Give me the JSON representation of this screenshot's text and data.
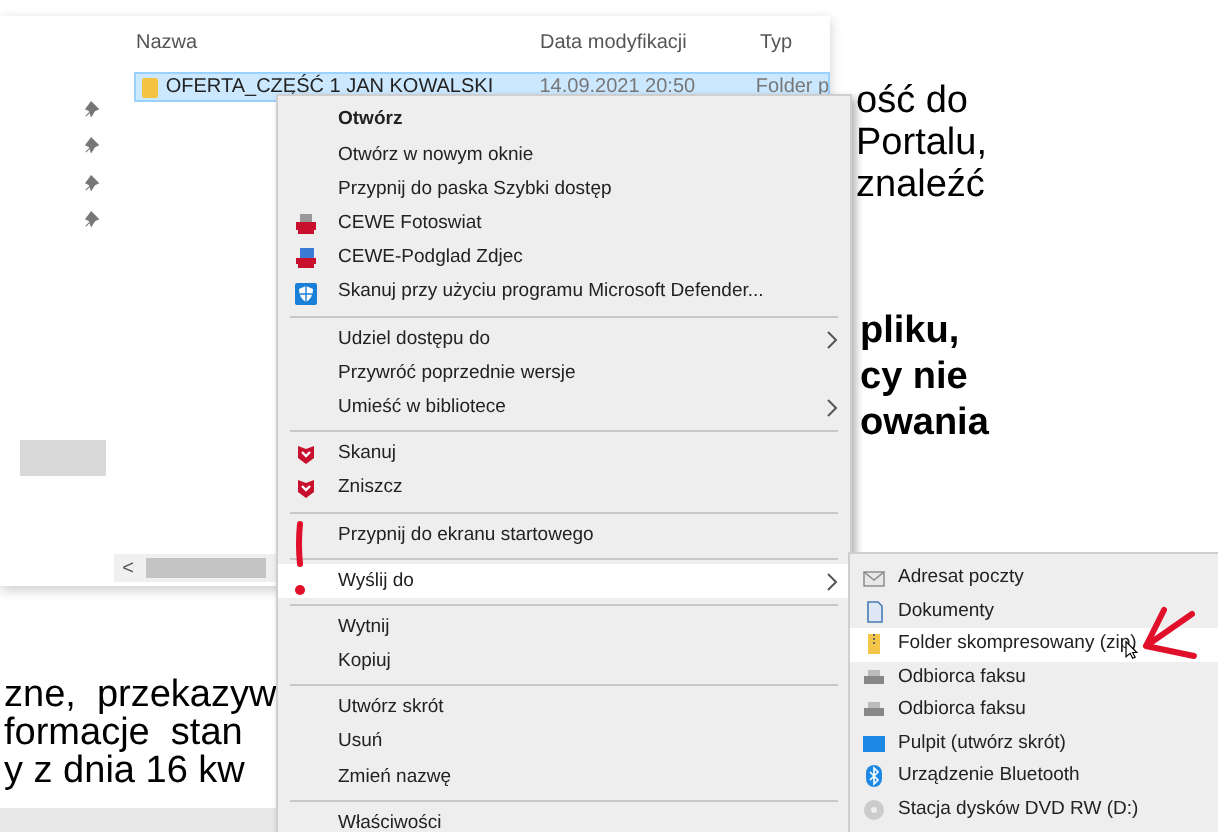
{
  "document": {
    "right_lines": [
      "ość do",
      "Portalu,",
      "znaleźć"
    ],
    "right_bold_lines": [
      "pliku,",
      "cy nie",
      "owania"
    ],
    "bottom_left_lines": [
      "zne,  przekazyw",
      "formacje  stan",
      "y z dnia 16 kw"
    ]
  },
  "explorer": {
    "columns": [
      "Nazwa",
      "Data modyfikacji",
      "Typ"
    ],
    "rows": [
      {
        "name": "OFERTA_CZĘŚĆ 1 JAN KOWALSKI",
        "date": "14.09.2021 20:50",
        "type": "Folder p",
        "selected": true
      }
    ],
    "scroll_left": "<"
  },
  "context_menu": [
    {
      "kind": "item",
      "label": "Otwórz",
      "default": true,
      "submenu": false,
      "selected": false
    },
    {
      "kind": "item",
      "label": "Otwórz w nowym oknie",
      "default": false,
      "submenu": false,
      "selected": false
    },
    {
      "kind": "item",
      "label": "Przypnij do paska Szybki dostęp",
      "default": false,
      "submenu": false,
      "selected": false
    },
    {
      "kind": "item",
      "label": "CEWE Fotoswiat",
      "default": false,
      "submenu": false,
      "selected": false
    },
    {
      "kind": "item",
      "label": "CEWE-Podglad Zdjec",
      "default": false,
      "submenu": false,
      "selected": false
    },
    {
      "kind": "item",
      "label": "Skanuj przy użyciu programu Microsoft Defender...",
      "default": false,
      "submenu": false,
      "selected": false
    },
    {
      "kind": "separator"
    },
    {
      "kind": "item",
      "label": "Udziel dostępu do",
      "default": false,
      "submenu": true,
      "selected": false
    },
    {
      "kind": "item",
      "label": "Przywróć poprzednie wersje",
      "default": false,
      "submenu": false,
      "selected": false
    },
    {
      "kind": "item",
      "label": "Umieść w bibliotece",
      "default": false,
      "submenu": true,
      "selected": false
    },
    {
      "kind": "separator"
    },
    {
      "kind": "item",
      "label": "Skanuj",
      "default": false,
      "submenu": false,
      "selected": false
    },
    {
      "kind": "item",
      "label": "Zniszcz",
      "default": false,
      "submenu": false,
      "selected": false
    },
    {
      "kind": "separator"
    },
    {
      "kind": "item",
      "label": "Przypnij do ekranu startowego",
      "default": false,
      "submenu": false,
      "selected": false
    },
    {
      "kind": "separator"
    },
    {
      "kind": "item",
      "label": "Wyślij do",
      "default": false,
      "submenu": true,
      "selected": true
    },
    {
      "kind": "separator"
    },
    {
      "kind": "item",
      "label": "Wytnij",
      "default": false,
      "submenu": false,
      "selected": false
    },
    {
      "kind": "item",
      "label": "Kopiuj",
      "default": false,
      "submenu": false,
      "selected": false
    },
    {
      "kind": "separator"
    },
    {
      "kind": "item",
      "label": "Utwórz skrót",
      "default": false,
      "submenu": false,
      "selected": false
    },
    {
      "kind": "item",
      "label": "Usuń",
      "default": false,
      "submenu": false,
      "selected": false
    },
    {
      "kind": "item",
      "label": "Zmień nazwę",
      "default": false,
      "submenu": false,
      "selected": false
    },
    {
      "kind": "separator"
    },
    {
      "kind": "item",
      "label": "Właściwości",
      "default": false,
      "submenu": false,
      "selected": false
    }
  ],
  "send_to_menu": [
    {
      "label": "Adresat poczty",
      "selected": false
    },
    {
      "label": "Dokumenty",
      "selected": false
    },
    {
      "label": "Folder skompresowany (zip)",
      "selected": true
    },
    {
      "label": "Odbiorca faksu",
      "selected": false
    },
    {
      "label": "Odbiorca faksu",
      "selected": false
    },
    {
      "label": "Pulpit (utwórz skrót)",
      "selected": false
    },
    {
      "label": "Urządzenie Bluetooth",
      "selected": false
    },
    {
      "label": "Stacja dysków DVD RW (D:)",
      "selected": false
    }
  ]
}
